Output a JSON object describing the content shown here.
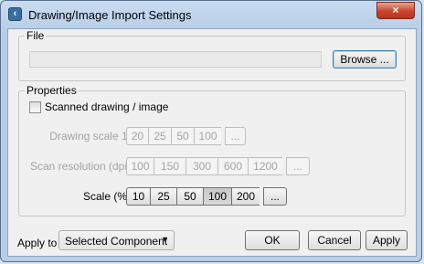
{
  "window": {
    "title": "Drawing/Image Import Settings",
    "close_glyph": "×"
  },
  "file": {
    "legend": "File",
    "path_value": "",
    "browse_label": "Browse ..."
  },
  "properties": {
    "legend": "Properties",
    "scanned_label": "Scanned drawing / image",
    "scanned_checked": false,
    "drawing_scale": {
      "label": "Drawing scale 1:",
      "options": [
        "20",
        "25",
        "50",
        "100",
        "..."
      ]
    },
    "scan_resolution": {
      "label": "Scan resolution (dpi)",
      "options": [
        "100",
        "150",
        "300",
        "600",
        "1200",
        "..."
      ]
    },
    "scale": {
      "label": "Scale (%)",
      "options": [
        "10",
        "25",
        "50",
        "100",
        "200",
        "..."
      ],
      "selected": "100"
    }
  },
  "footer": {
    "apply_to_label": "Apply to",
    "apply_to_value": "Selected Component",
    "ok_label": "OK",
    "cancel_label": "Cancel",
    "apply_label": "Apply"
  },
  "colors": {
    "title_bar": "#c9dcf0",
    "close_button": "#c8442e",
    "focus_border": "#3c7fb1"
  }
}
